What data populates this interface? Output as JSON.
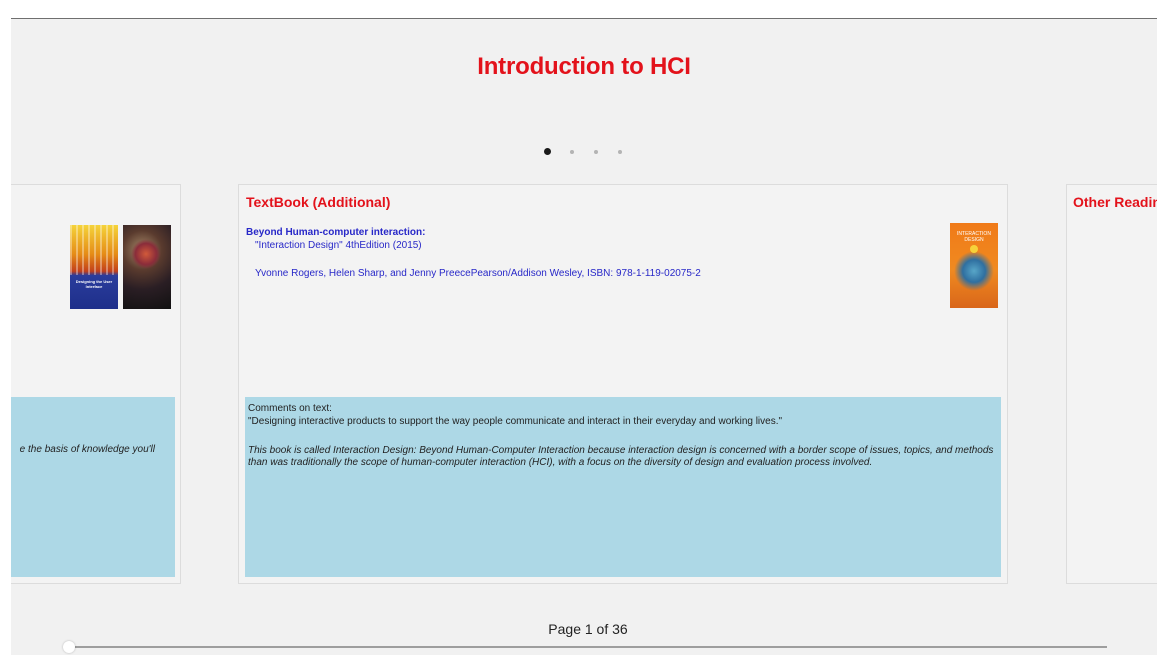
{
  "title": "Introduction to HCI",
  "pager": {
    "dot_count": 4,
    "active_index": 0
  },
  "center_card": {
    "heading": "TextBook (Additional)",
    "book_title": "Beyond Human-computer interaction:",
    "book_edition": "\"Interaction Design\" 4thEdition (2015)",
    "book_authors": "Yvonne Rogers, Helen Sharp, and Jenny PreecePearson/Addison Wesley, ISBN: 978-1-119-02075-2",
    "cover_title": "INTERACTION DESIGN",
    "comments_label": "Comments on text:",
    "comments_quote": "\"Designing interactive products to support the way people communicate and interact in their everyday and working lives.\"",
    "comments_body": "This book is called Interaction Design: Beyond Human-Computer Interaction because interaction design is concerned with a border scope of issues, topics, and methods than was traditionally the scope of human-computer interaction (HCI), with a focus on the diversity of design and evaluation process involved."
  },
  "left_card": {
    "italic_text": "e the basis of knowledge you'll",
    "cover_caption": "Designing the User Interface"
  },
  "right_card": {
    "heading": "Other Readin"
  },
  "footer": {
    "page_label": "Page 1 of 36",
    "progress": 0.0
  },
  "colors": {
    "accent": "#e3121b",
    "link": "#2828c8",
    "comment_bg": "#add8e6",
    "page_bg": "#f1f1f1"
  }
}
